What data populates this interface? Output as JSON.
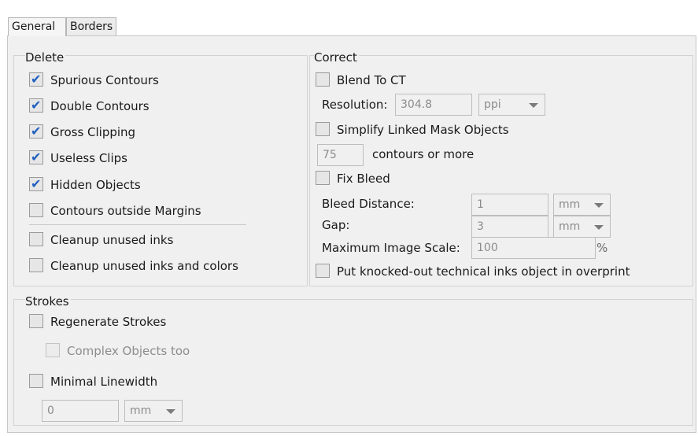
{
  "tabs": [
    {
      "label": "General"
    },
    {
      "label": "Borders"
    }
  ],
  "delete": {
    "title": "Delete",
    "items": [
      {
        "label": "Spurious Contours",
        "checked": true
      },
      {
        "label": "Double Contours",
        "checked": true
      },
      {
        "label": "Gross Clipping",
        "checked": true
      },
      {
        "label": "Useless Clips",
        "checked": true
      },
      {
        "label": "Hidden Objects",
        "checked": true
      },
      {
        "label": "Contours outside Margins",
        "checked": false
      },
      {
        "label": "Cleanup unused inks",
        "checked": false
      },
      {
        "label": "Cleanup unused inks and colors",
        "checked": false
      }
    ]
  },
  "correct": {
    "title": "Correct",
    "blend_to_ct": {
      "label": "Blend To CT",
      "checked": false
    },
    "resolution": {
      "label": "Resolution:",
      "value": "304.8",
      "unit": "ppi"
    },
    "simplify": {
      "label": "Simplify Linked Mask Objects",
      "checked": false
    },
    "contours": {
      "value": "75",
      "label": "contours or more"
    },
    "fix_bleed": {
      "label": "Fix Bleed",
      "checked": false
    },
    "bleed_distance": {
      "label": "Bleed Distance:",
      "value": "1",
      "unit": "mm"
    },
    "gap": {
      "label": "Gap:",
      "value": "3",
      "unit": "mm"
    },
    "max_scale": {
      "label": "Maximum Image Scale:",
      "value": "100",
      "suffix": "%"
    },
    "knocked_out": {
      "label": "Put knocked-out technical inks object in overprint",
      "checked": false
    }
  },
  "strokes": {
    "title": "Strokes",
    "regenerate": {
      "label": "Regenerate Strokes",
      "checked": false
    },
    "complex": {
      "label": "Complex Objects too",
      "checked": false
    },
    "minimal": {
      "label": "Minimal Linewidth",
      "checked": false
    },
    "linewidth": {
      "value": "0",
      "unit": "mm"
    }
  }
}
